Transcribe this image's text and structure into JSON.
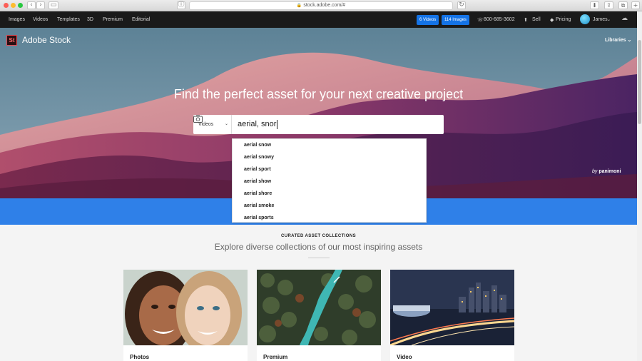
{
  "browser": {
    "url": "stock.adobe.com/#",
    "back": "‹",
    "forward": "›"
  },
  "topnav": {
    "links": [
      "Images",
      "Videos",
      "Templates",
      "3D",
      "Premium",
      "Editorial"
    ],
    "videos_pill": "6 Videos",
    "images_pill": "114 Images",
    "phone": "800-685-3602",
    "sell": "Sell",
    "pricing": "Pricing",
    "user": "James"
  },
  "hero": {
    "logo_badge": "St",
    "logo_text": "Adobe Stock",
    "libraries": "Libraries",
    "title": "Find the perfect asset for your next creative project",
    "credit_by": "by",
    "credit_name": "panimoni"
  },
  "search": {
    "type": "Videos",
    "query": "aerial, snor"
  },
  "suggestions": [
    "aerial snow",
    "aerial snowy",
    "aerial sport",
    "aerial show",
    "aerial shore",
    "aerial smoke",
    "aerial sports"
  ],
  "collections": {
    "label": "CURATED ASSET COLLECTIONS",
    "title": "Explore diverse collections of our most inspiring assets",
    "cards": [
      {
        "label": "Photos"
      },
      {
        "label": "Premium"
      },
      {
        "label": "Video"
      }
    ]
  },
  "colors": {
    "accent": "#1473e6",
    "band": "#2f80e8",
    "nav": "#1a1a1a"
  }
}
